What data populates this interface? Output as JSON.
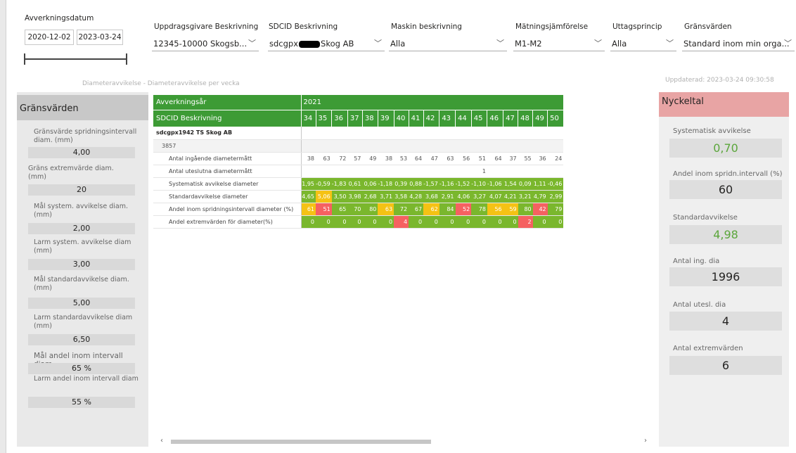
{
  "filters": {
    "date": {
      "label": "Avverkningsdatum",
      "from": "2020-12-02",
      "to": "2023-03-24"
    },
    "uppdragsgivare": {
      "label": "Uppdragsgivare Beskrivning",
      "value": "12345-10000 Skogsb..."
    },
    "sdcid": {
      "label": "SDCID Beskrivning",
      "value_prefix": "sdcgpx",
      "value_suffix": "Skog AB"
    },
    "maskin": {
      "label": "Maskin beskrivning",
      "value": "Alla"
    },
    "matning": {
      "label": "Mätningsjämförelse",
      "value": "M1-M2"
    },
    "uttag": {
      "label": "Uttagsprincip",
      "value": "Alla"
    },
    "grans": {
      "label": "Gränsvärden",
      "value": "Standard inom min orga..."
    }
  },
  "subtitle": "Diameteravvikelse - Diameteravvikelse per vecka",
  "updated": "Uppdaterad: 2023-03-24 09:30:58",
  "left_panel": {
    "title": "Gränsvärden",
    "items": [
      {
        "label": "Gränsvärde spridningsintervall diam. (mm)",
        "value": "4,00"
      },
      {
        "label": "Gräns extremvärde diam. (mm)",
        "value": "20"
      },
      {
        "label": "Mål system. avvikelse diam. (mm)",
        "value": "2,00"
      },
      {
        "label": "Larm system. avvikelse diam (mm)",
        "value": "3,00"
      },
      {
        "label": "Mål standardavvikelse diam. (mm)",
        "value": "5,00"
      },
      {
        "label": "Larm standardavvikelse diam (mm)",
        "value": "6,50"
      },
      {
        "label": "Mål andel inom intervall diam.",
        "value": "65 %"
      },
      {
        "label": "Larm andel inom intervall diam",
        "value": "55 %"
      }
    ]
  },
  "right_panel": {
    "title": "Nyckeltal",
    "items": [
      {
        "label": "Systematisk avvikelse",
        "value": "0,70",
        "color": "green"
      },
      {
        "label": "Andel inom spridn.intervall (%)",
        "value": "60",
        "color": "dark"
      },
      {
        "label": "Standardavvikelse",
        "value": "4,98",
        "color": "green"
      },
      {
        "label": "Antal ing. dia",
        "value": "1996",
        "color": "dark"
      },
      {
        "label": "Antal utesl. dia",
        "value": "4",
        "color": "dark"
      },
      {
        "label": "Antal extremvärden",
        "value": "6",
        "color": "dark"
      }
    ]
  },
  "table": {
    "header1_label": "Avverkningsår",
    "year": "2021",
    "header2_label": "SDCID Beskrivning",
    "weeks": [
      "34",
      "35",
      "36",
      "37",
      "38",
      "39",
      "40",
      "41",
      "42",
      "43",
      "44",
      "45",
      "46",
      "47",
      "48",
      "49",
      "50"
    ],
    "group": "sdcgpx1942 TS Skog AB",
    "subgroup": "3857",
    "rows": [
      {
        "label": "Antal ingående diametermått",
        "values": [
          "38",
          "63",
          "72",
          "57",
          "49",
          "38",
          "53",
          "64",
          "47",
          "63",
          "56",
          "51",
          "64",
          "37",
          "55",
          "36",
          "24"
        ],
        "colors": [
          "",
          "",
          "",
          "",
          "",
          "",
          "",
          "",
          "",
          "",
          "",
          "",
          "",
          "",
          "",
          "",
          ""
        ]
      },
      {
        "label": "Antal uteslutna diametermått",
        "values": [
          "",
          "",
          "",
          "",
          "",
          "",
          "",
          "",
          "",
          "",
          "",
          "1",
          "",
          "",
          "",
          "",
          ""
        ],
        "colors": [
          "",
          "",
          "",
          "",
          "",
          "",
          "",
          "",
          "",
          "",
          "",
          "",
          "",
          "",
          "",
          "",
          ""
        ]
      },
      {
        "label": "Systematisk avvikelse diameter",
        "values": [
          "1,95",
          "-0,59",
          "-1,83",
          "0,61",
          "0,06",
          "-1,18",
          "0,39",
          "0,88",
          "-1,57",
          "-1,16",
          "-1,52",
          "-1,10",
          "-1,06",
          "1,54",
          "0,09",
          "1,11",
          "-0,46"
        ],
        "colors": [
          "g",
          "g",
          "g",
          "g",
          "g",
          "g",
          "g",
          "g",
          "g",
          "g",
          "g",
          "g",
          "g",
          "g",
          "g",
          "g",
          "g"
        ]
      },
      {
        "label": "Standardavvikelse diameter",
        "values": [
          "4,65",
          "5,06",
          "3,50",
          "3,98",
          "2,68",
          "3,71",
          "3,58",
          "4,28",
          "3,68",
          "2,91",
          "4,06",
          "3,27",
          "4,07",
          "4,21",
          "3,21",
          "4,79",
          "2,99"
        ],
        "colors": [
          "g",
          "y",
          "g",
          "g",
          "g",
          "g",
          "g",
          "g",
          "g",
          "g",
          "g",
          "g",
          "g",
          "g",
          "g",
          "g",
          "g"
        ]
      },
      {
        "label": "Andel inom spridningsintervall diameter (%)",
        "values": [
          "61",
          "51",
          "65",
          "70",
          "80",
          "63",
          "72",
          "67",
          "62",
          "84",
          "52",
          "78",
          "56",
          "59",
          "80",
          "42",
          "79"
        ],
        "colors": [
          "y",
          "r",
          "g",
          "g",
          "g",
          "y",
          "g",
          "g",
          "y",
          "g",
          "r",
          "g",
          "y",
          "y",
          "g",
          "r",
          "g"
        ]
      },
      {
        "label": "Andel extremvärden för diameter(%)",
        "values": [
          "0",
          "0",
          "0",
          "0",
          "0",
          "0",
          "4",
          "0",
          "0",
          "0",
          "0",
          "0",
          "0",
          "0",
          "2",
          "0",
          "0"
        ],
        "colors": [
          "g",
          "g",
          "g",
          "g",
          "g",
          "g",
          "r",
          "g",
          "g",
          "g",
          "g",
          "g",
          "g",
          "g",
          "r",
          "g",
          "g"
        ]
      }
    ]
  }
}
